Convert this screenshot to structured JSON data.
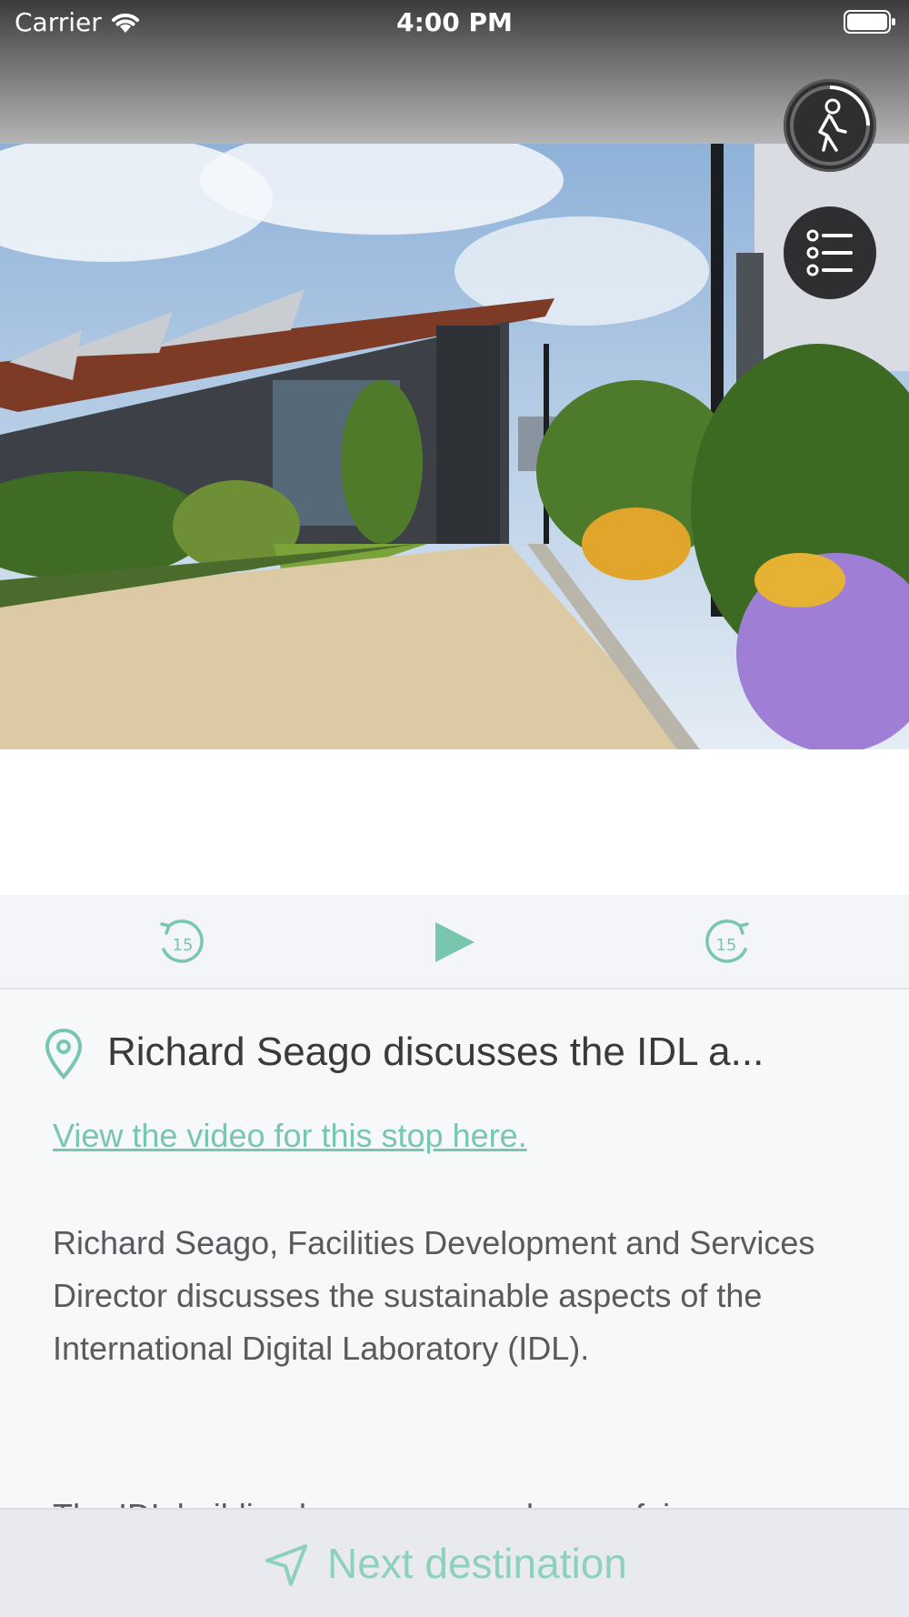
{
  "status_bar": {
    "carrier": "Carrier",
    "time": "4:00 PM",
    "icons": [
      "wifi-icon",
      "battery-icon"
    ]
  },
  "hero": {
    "icon": "building-photo"
  },
  "floating_buttons": {
    "walk_icon": "walking-person-icon",
    "list_icon": "list-icon"
  },
  "audio": {
    "rewind_seconds": "15",
    "forward_seconds": "15",
    "play_icon": "play-icon"
  },
  "stop": {
    "title": "Richard Seago discusses the IDL a...",
    "video_link": "View the video for this stop here.",
    "description": "Richard Seago, Facilities Development and Services Director discusses the sustainable aspects of the International Digital Laboratory (IDL).",
    "description_cont": "The IDL building has a green sedum roof, is"
  },
  "bottom": {
    "next_label": "Next destination",
    "icon": "navigation-arrow-icon"
  },
  "colors": {
    "accent": "#78c6ad",
    "accent_light": "#8ed1bb",
    "fab_bg": "#2f2f31"
  }
}
